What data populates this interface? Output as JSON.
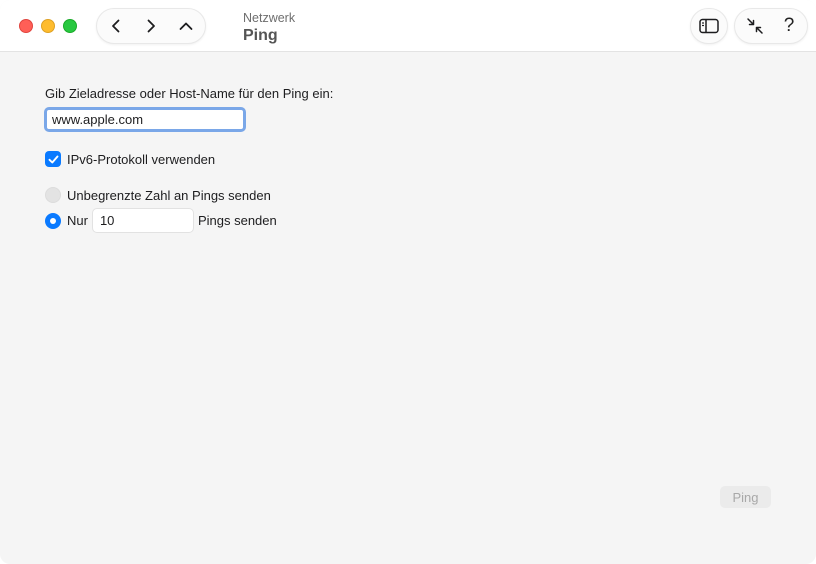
{
  "window": {
    "breadcrumb": "Netzwerk",
    "title": "Ping"
  },
  "toolbar": {
    "back_icon": "chevron-left",
    "forward_icon": "chevron-right",
    "up_icon": "chevron-up",
    "sidebar_icon": "sidebar-toggle",
    "collapse_icon": "collapse-arrows",
    "help_label": "?"
  },
  "form": {
    "prompt_label": "Gib Zieladresse oder Host-Name für den Ping ein:",
    "host_value": "www.apple.com",
    "ipv6_label": "IPv6-Protokoll verwenden",
    "ipv6_checked": true,
    "unlimited_label": "Unbegrenzte Zahl an Pings senden",
    "only_prefix": "Nur",
    "count_value": "10",
    "only_suffix": "Pings senden",
    "selected_option": "limited"
  },
  "actions": {
    "ping_label": "Ping"
  },
  "colors": {
    "accent": "#0a7aff",
    "focus_ring": "#7aa7e8",
    "close": "#ff5f57",
    "minimize": "#febc2e",
    "zoom": "#28c840"
  }
}
